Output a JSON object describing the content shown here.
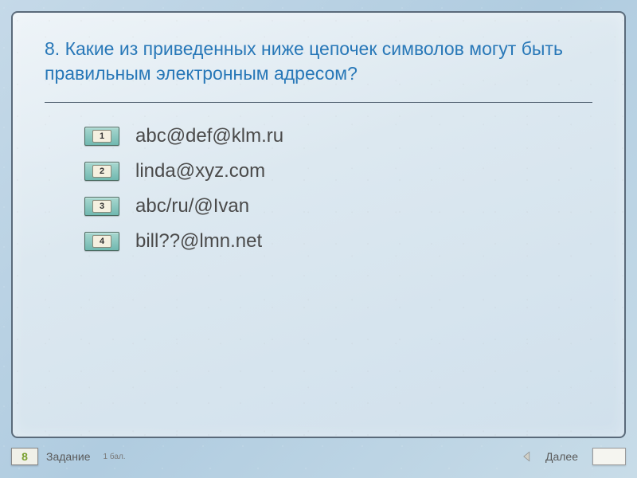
{
  "question": "8. Какие из приведенных ниже цепочек символов могут быть правильным электронным адресом?",
  "options": [
    {
      "num": "1",
      "text": "abc@def@klm.ru"
    },
    {
      "num": "2",
      "text": "linda@xyz.com"
    },
    {
      "num": "3",
      "text": "abc/ru/@Ivan"
    },
    {
      "num": "4",
      "text": "bill??@lmn.net"
    }
  ],
  "footer": {
    "task_num": "8",
    "task_label": "Задание",
    "points": "1 бал.",
    "next_label": "Далее"
  }
}
